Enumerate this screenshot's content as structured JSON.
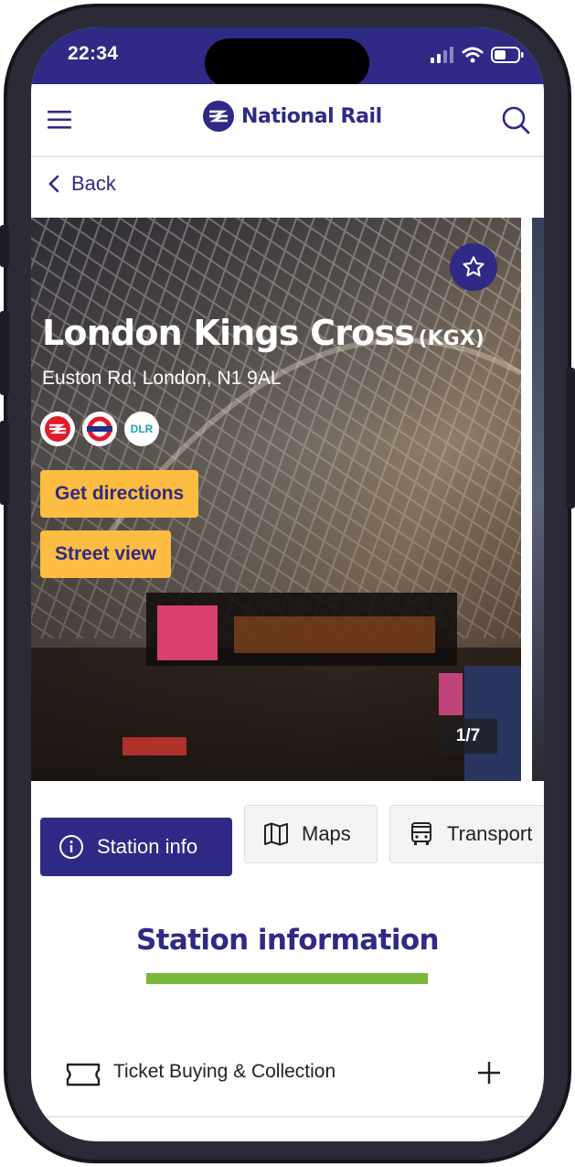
{
  "status_bar": {
    "time": "22:34"
  },
  "header": {
    "brand": "National Rail"
  },
  "nav": {
    "back_label": "Back"
  },
  "station": {
    "name": "London Kings Cross",
    "code": "(KGX)",
    "address": "Euston Rd, London, N1 9AL",
    "services": [
      "National Rail",
      "London Underground",
      "DLR"
    ],
    "dlr_label": "DLR",
    "actions": {
      "directions": "Get directions",
      "street_view": "Street view"
    },
    "photo_counter": "1/7"
  },
  "tabs": [
    {
      "label": "Station info",
      "icon": "info-icon",
      "active": true
    },
    {
      "label": "Maps",
      "icon": "map-icon",
      "active": false
    },
    {
      "label": "Transport",
      "icon": "bus-icon",
      "active": false
    }
  ],
  "section": {
    "title": "Station information",
    "items": [
      {
        "label": "Ticket Buying & Collection",
        "icon": "ticket-icon"
      }
    ]
  },
  "colors": {
    "brand": "#2e2a86",
    "accent_yellow": "#fdbc42",
    "accent_green": "#78b83a"
  }
}
